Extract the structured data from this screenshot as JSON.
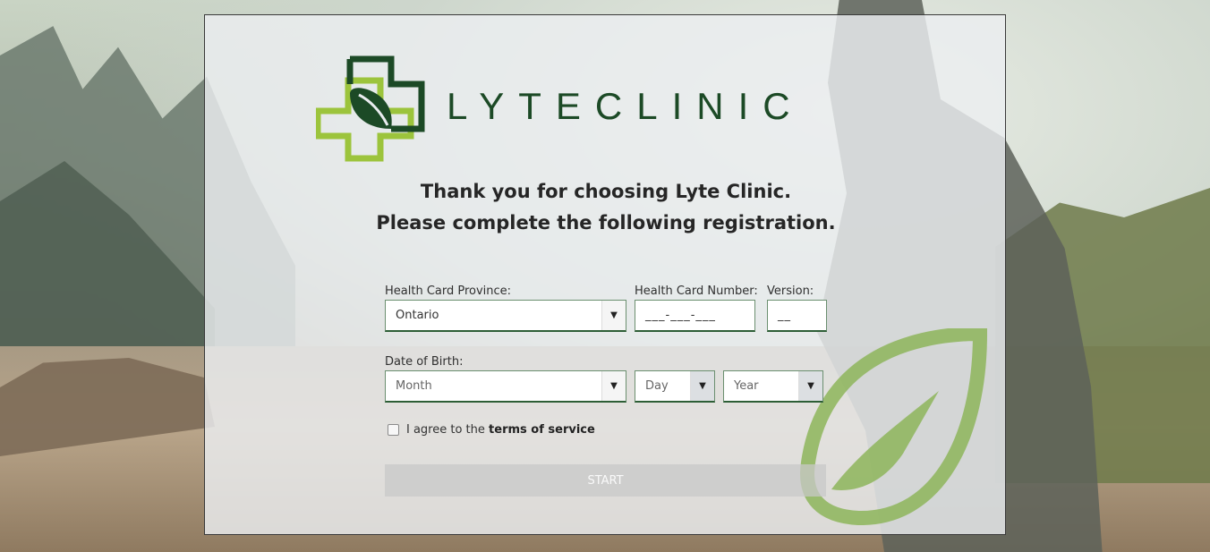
{
  "brand": {
    "name": "LYTECLINIC",
    "logo_icon": "cross-leaf-icon",
    "colors": {
      "dark_green": "#1c4a26",
      "light_green": "#9cc43c"
    }
  },
  "headline": {
    "line1": "Thank you for choosing Lyte Clinic.",
    "line2": "Please complete the following registration."
  },
  "form": {
    "province": {
      "label": "Health Card Province:",
      "value": "Ontario"
    },
    "card_number": {
      "label": "Health Card Number:",
      "value": "___-___-___"
    },
    "version": {
      "label": "Version:",
      "value": "__"
    },
    "dob": {
      "label": "Date of Birth:",
      "month": "Month",
      "day": "Day",
      "year": "Year"
    },
    "terms": {
      "prefix": "I agree to the ",
      "link": "terms of service",
      "checked": false
    },
    "start_label": "START"
  }
}
